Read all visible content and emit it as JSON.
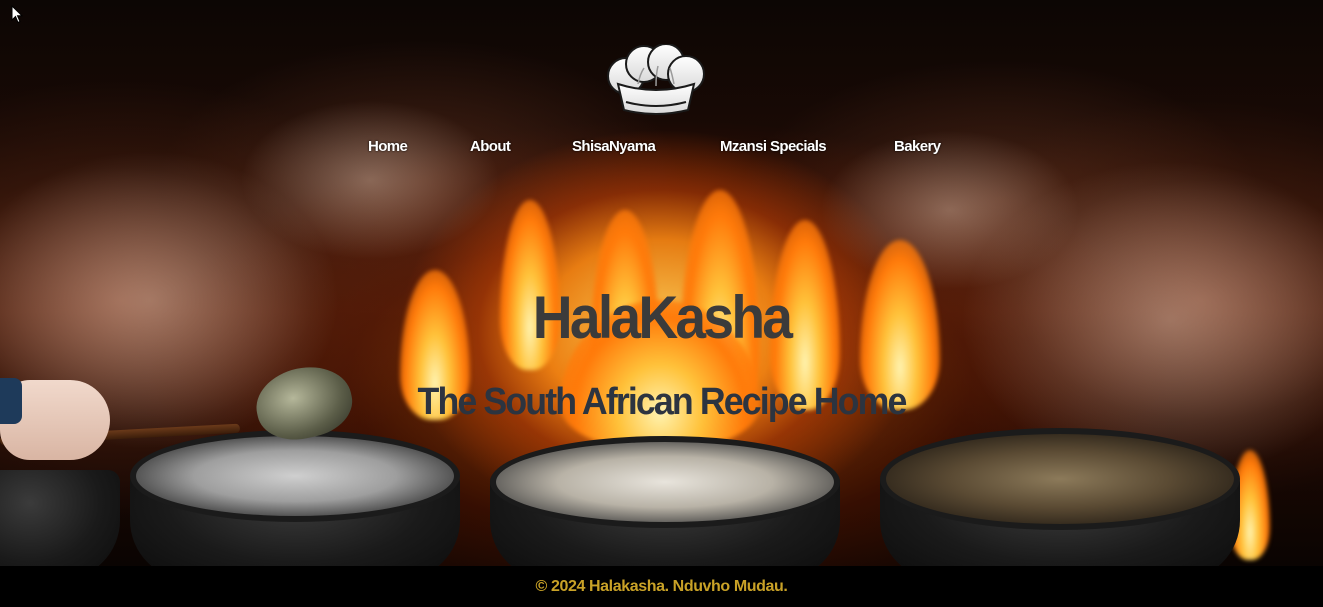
{
  "header": {
    "logo_icon": "chef-hat-icon"
  },
  "nav": {
    "items": [
      {
        "label": "Home"
      },
      {
        "label": "About"
      },
      {
        "label": "ShisaNyama"
      },
      {
        "label": "Mzansi Specials"
      },
      {
        "label": "Bakery"
      }
    ]
  },
  "hero": {
    "title": "HalaKasha",
    "subtitle": "The South African Recipe Home",
    "background": "fire-and-pots-image"
  },
  "footer": {
    "text": "© 2024 Halakasha. Nduvho Mudau."
  },
  "colors": {
    "nav_text": "#ffffff",
    "title_text": "#3b3b3b",
    "subtitle_text": "#2c3440",
    "footer_text": "#c9a227",
    "footer_bg": "#000000"
  }
}
